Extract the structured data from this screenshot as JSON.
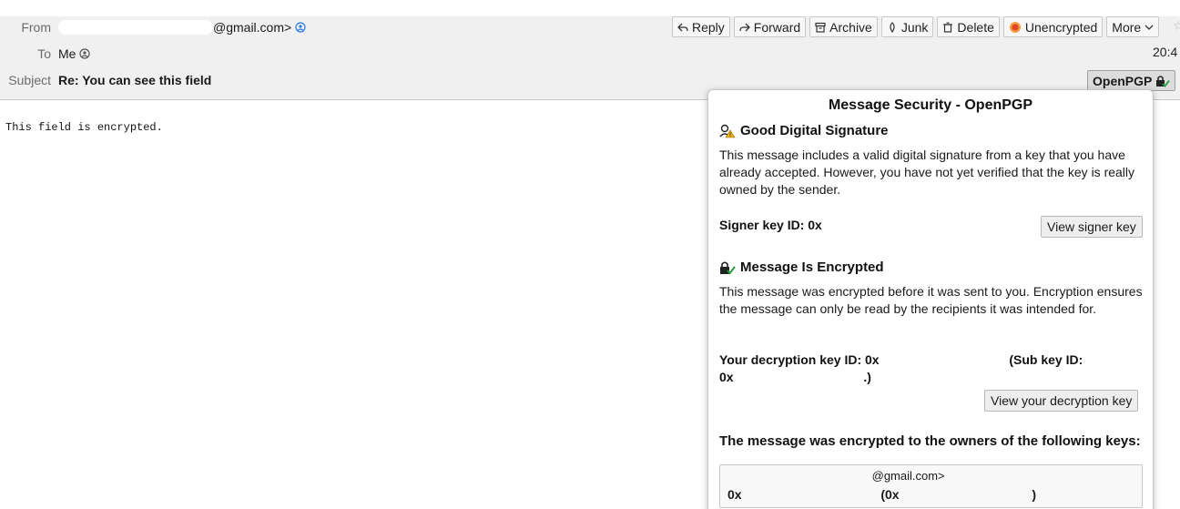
{
  "header": {
    "from_label": "From",
    "from_value": "@gmail.com>",
    "to_label": "To",
    "to_value": "Me",
    "subject_label": "Subject",
    "subject_value": "Re: You can see this field",
    "time": "20:4"
  },
  "toolbar": {
    "reply": "Reply",
    "forward": "Forward",
    "archive": "Archive",
    "junk": "Junk",
    "delete": "Delete",
    "unencrypted": "Unencrypted",
    "more": "More"
  },
  "openpgp_button": "OpenPGP",
  "message_body": "This field is encrypted.",
  "popup": {
    "title": "Message Security - OpenPGP",
    "signature": {
      "heading": "Good Digital Signature",
      "text": "This message includes a valid digital signature from a key that you have already accepted. However, you have not yet verified that the key is really owned by the sender.",
      "signer_label": "Signer key ID: 0x",
      "view_button": "View signer key"
    },
    "encryption": {
      "heading": "Message Is Encrypted",
      "text": "This message was encrypted before it was sent to you. Encryption ensures the message can only be read by the recipients it was intended for.",
      "decrypt_label": "Your decryption key ID: 0x",
      "subkey_label": "(Sub key ID:",
      "subkey_prefix": "0x",
      "subkey_suffix": ".)",
      "view_button": "View your decryption key"
    },
    "owners": {
      "heading": "The message was encrypted to the owners of the following keys:",
      "entry_email": "@gmail.com>",
      "entry_key_prefix": "0x",
      "entry_subkey_prefix": "(0x",
      "entry_subkey_suffix": ")"
    }
  }
}
